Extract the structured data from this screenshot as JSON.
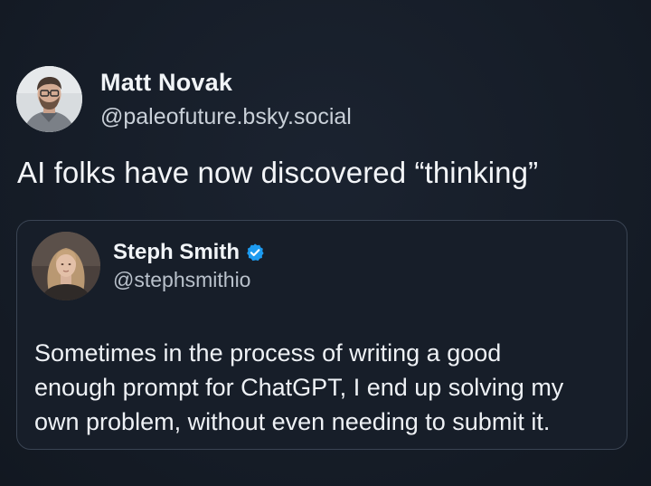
{
  "post": {
    "author": {
      "name": "Matt Novak",
      "handle": "@paleofuture.bsky.social",
      "avatar_icon": "avatar-photo-man-glasses"
    },
    "text": "AI folks have now discovered “thinking”"
  },
  "quoted_post": {
    "author": {
      "name": "Steph Smith",
      "handle": "@stephsmithio",
      "avatar_icon": "avatar-photo-woman",
      "verified": true,
      "verified_icon": "verified-badge-icon",
      "verified_color": "#1d9bf0"
    },
    "lines": [
      "Sometimes in the process of writing a good",
      "enough prompt for ChatGPT, I end up solving my",
      "own problem, without even needing to submit it."
    ]
  },
  "colors": {
    "background": "#161d28",
    "card_border": "#3a4453",
    "text_primary": "#f1f4f7",
    "text_secondary": "#c9d0d8"
  }
}
